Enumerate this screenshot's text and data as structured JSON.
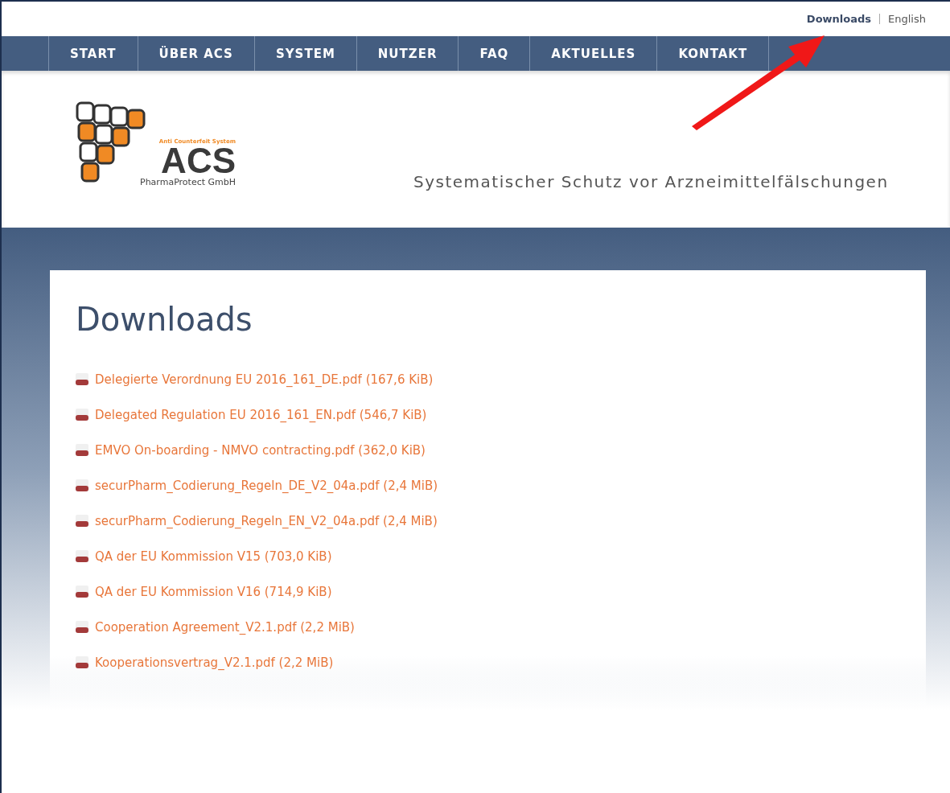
{
  "top_links": [
    {
      "label": "Downloads",
      "selected": true
    },
    {
      "label": "English",
      "selected": false
    }
  ],
  "nav": [
    {
      "label": "START"
    },
    {
      "label": "ÜBER ACS"
    },
    {
      "label": "SYSTEM"
    },
    {
      "label": "NUTZER"
    },
    {
      "label": "FAQ"
    },
    {
      "label": "AKTUELLES"
    },
    {
      "label": "KONTAKT"
    }
  ],
  "logo": {
    "tagline": "Anti Counterfeit System",
    "name": "ACS",
    "company": "PharmaProtect GmbH"
  },
  "slogan": "Systematischer Schutz vor Arzneimittelfälschungen",
  "page_title": "Downloads",
  "downloads": [
    {
      "label": "Delegierte Verordnung EU 2016_161_DE.pdf (167,6 KiB)"
    },
    {
      "label": "Delegated Regulation EU 2016_161_EN.pdf (546,7 KiB)"
    },
    {
      "label": "EMVO On-boarding - NMVO contracting.pdf (362,0 KiB)"
    },
    {
      "label": "securPharm_Codierung_Regeln_DE_V2_04a.pdf (2,4 MiB)"
    },
    {
      "label": "securPharm_Codierung_Regeln_EN_V2_04a.pdf (2,4 MiB)"
    },
    {
      "label": "QA der EU Kommission V15 (703,0 KiB)"
    },
    {
      "label": "QA der EU Kommission V16 (714,9 KiB)"
    },
    {
      "label": "Cooperation Agreement_V2.1.pdf (2,2 MiB)"
    },
    {
      "label": "Kooperationsvertrag_V2.1.pdf (2,2 MiB)"
    }
  ]
}
